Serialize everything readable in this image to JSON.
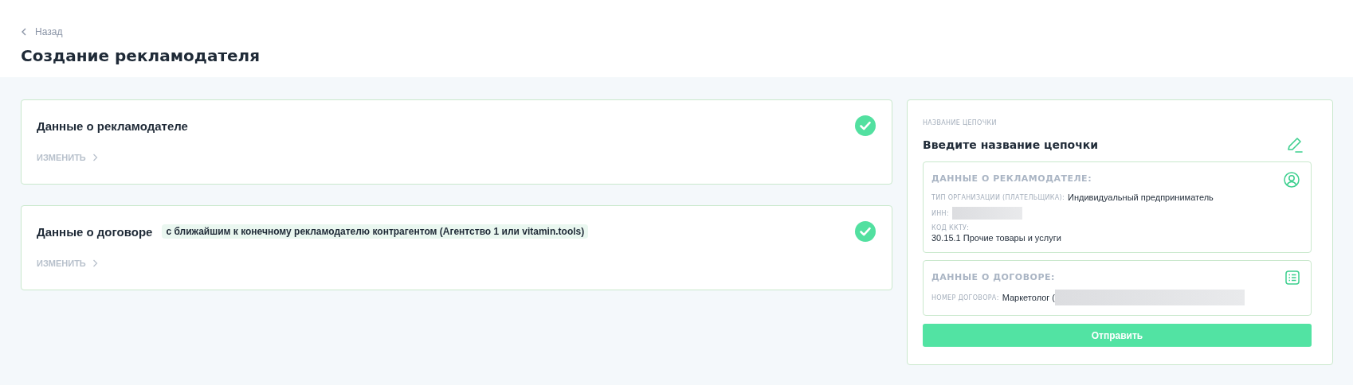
{
  "header": {
    "back_link": "Назад",
    "title": "Создание рекламодателя"
  },
  "steps": [
    {
      "title": "Данные о рекламодателе",
      "completed": true,
      "action": "ИЗМЕНИТЬ"
    },
    {
      "title": "Данные о договоре",
      "tag": "с ближайшим к конечному рекламодателю контрагентом (Агентство 1 или vitamin.tools)",
      "completed": true,
      "action": "ИЗМЕНИТЬ"
    }
  ],
  "summary": {
    "caption": "НАЗВАНИЕ ЦЕПОЧКИ",
    "chain_name": "Введите название цепочки",
    "sections": [
      {
        "kind": "person",
        "title": "ДАННЫЕ О РЕКЛАМОДАТЕЛЕ:",
        "fields": [
          {
            "kind": "inline",
            "label": "ТИП ОРГАНИЗАЦИИ (ПЛАТЕЛЬЩИКА):",
            "value": "Индивидуальный предприниматель"
          },
          {
            "kind": "redacted",
            "label": "ИНН:"
          },
          {
            "kind": "stacked",
            "label": "КОД ККТУ:",
            "value": "30.15.1 Прочие товары и услуги"
          }
        ]
      },
      {
        "kind": "list",
        "title": "ДАННЫЕ О ДОГОВОРЕ:",
        "fields": [
          {
            "kind": "redacted",
            "label": "НОМЕР ДОГОВОРА:",
            "value": "Маркетолог ("
          }
        ]
      }
    ],
    "submit": "Отправить"
  }
}
